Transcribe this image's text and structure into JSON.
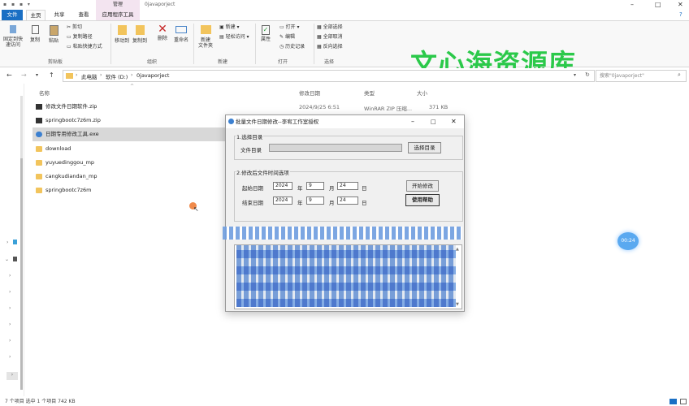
{
  "titlebar": {
    "context_label": "管理",
    "path": "0javaporject",
    "minimize": "–",
    "maximize": "□",
    "close": "✕",
    "help": "?"
  },
  "tabs": {
    "file": "文件",
    "home": "主页",
    "share": "共享",
    "view": "查看",
    "apptools": "应用程序工具"
  },
  "ribbon": {
    "pin": "固定到快\n速访问",
    "copy": "复制",
    "paste": "粘贴",
    "cut": "剪切",
    "copy_path": "复制路径",
    "paste_shortcut": "粘贴快捷方式",
    "group_clipboard": "剪贴板",
    "move_to": "移动到",
    "copy_to": "复制到",
    "delete": "删除",
    "rename": "重命名",
    "group_organize": "组织",
    "new_folder": "新建\n文件夹",
    "new_item": "新建",
    "easy_access": "轻松访问",
    "group_new": "新建",
    "properties": "属性",
    "open": "打开",
    "edit": "编辑",
    "history": "历史记录",
    "group_open": "打开",
    "select_all": "全部选择",
    "select_none": "全部取消",
    "invert": "反向选择",
    "group_select": "选择"
  },
  "address": {
    "crumbs": [
      "此电脑",
      "软件 (D:)",
      "0javaporject"
    ],
    "search_placeholder": "搜索\"0javaporject\""
  },
  "columns": {
    "name": "名称",
    "modified": "修改日期",
    "type": "类型",
    "size": "大小"
  },
  "files": [
    {
      "name": "修改文件日期软件.zip",
      "modified": "2024/9/25 6:51",
      "type": "WinRAR ZIP 压缩...",
      "size": "371 KB",
      "kind": "zip"
    },
    {
      "name": "springbootc7z6m.zip",
      "modified": "",
      "type": "",
      "size": "",
      "kind": "zip"
    },
    {
      "name": "日期专用修改工具.exe",
      "modified": "",
      "type": "",
      "size": "",
      "kind": "exe"
    },
    {
      "name": "download",
      "modified": "",
      "type": "",
      "size": "",
      "kind": "folder"
    },
    {
      "name": "yuyuedinggou_mp",
      "modified": "",
      "type": "",
      "size": "",
      "kind": "folder"
    },
    {
      "name": "cangkudiandan_mp",
      "modified": "",
      "type": "",
      "size": "",
      "kind": "folder"
    },
    {
      "name": "springbootc7z6m",
      "modified": "",
      "type": "",
      "size": "",
      "kind": "folder"
    }
  ],
  "dialog": {
    "title": "批量文件日期修改--李宥工作室授权",
    "sec1": "1.选择目录",
    "dir_label": "文件目录",
    "choose_btn": "选择目录",
    "sec2": "2.修改后文件时间选项",
    "start_label": "起始日期",
    "end_label": "结束日期",
    "start": {
      "year": "2024",
      "month": "9",
      "day": "24"
    },
    "end": {
      "year": "2024",
      "month": "9",
      "day": "24"
    },
    "year": "年",
    "month": "月",
    "day": "日",
    "start_btn": "开始修改",
    "help_btn": "使用帮助"
  },
  "watermark": "文心海资源库",
  "badge": "00:24",
  "status": "7 个项目   选中 1 个项目  742 KB"
}
